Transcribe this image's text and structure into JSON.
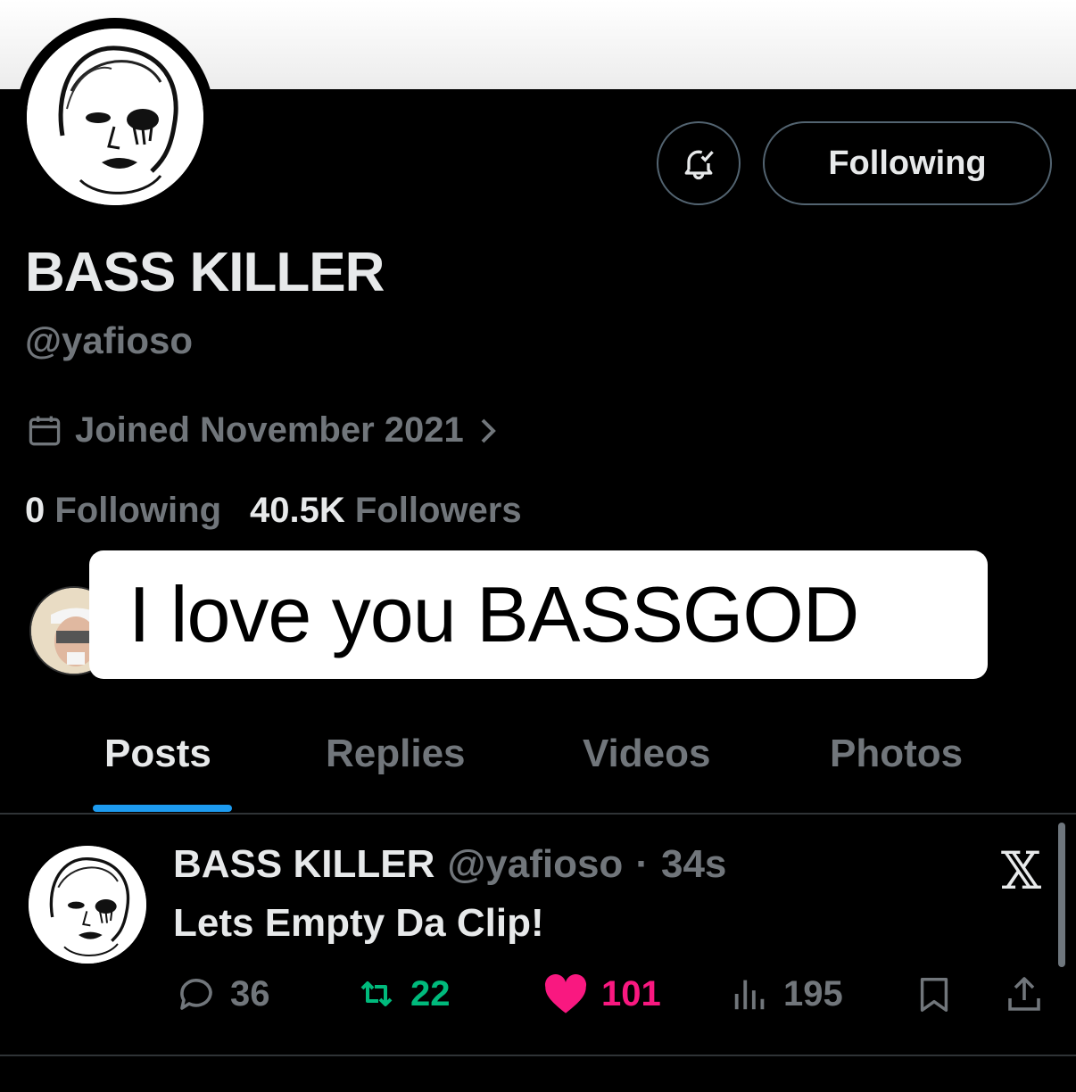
{
  "profile": {
    "display_name": "BASS KILLER",
    "handle": "@yafioso",
    "joined": "Joined November 2021",
    "following_count": "0",
    "following_label": "Following",
    "followers_count": "40.5K",
    "followers_label": "Followers",
    "follow_button_label": "Following"
  },
  "overlay_caption": "I love you BASSGOD",
  "tabs": [
    {
      "label": "Posts",
      "active": true
    },
    {
      "label": "Replies",
      "active": false
    },
    {
      "label": "Videos",
      "active": false
    },
    {
      "label": "Photos",
      "active": false
    }
  ],
  "post": {
    "name": "BASS KILLER",
    "handle": "@yafioso",
    "dot": "·",
    "time": "34s",
    "text": "Lets Empty Da Clip!",
    "replies": "36",
    "reposts": "22",
    "likes": "101",
    "views": "195"
  },
  "colors": {
    "background": "#000000",
    "primary_text": "#e7e9ea",
    "secondary_text": "#71767b",
    "tab_indicator": "#1d9bf0",
    "repost_green": "#00ba7c",
    "like_pink": "#f91880"
  }
}
